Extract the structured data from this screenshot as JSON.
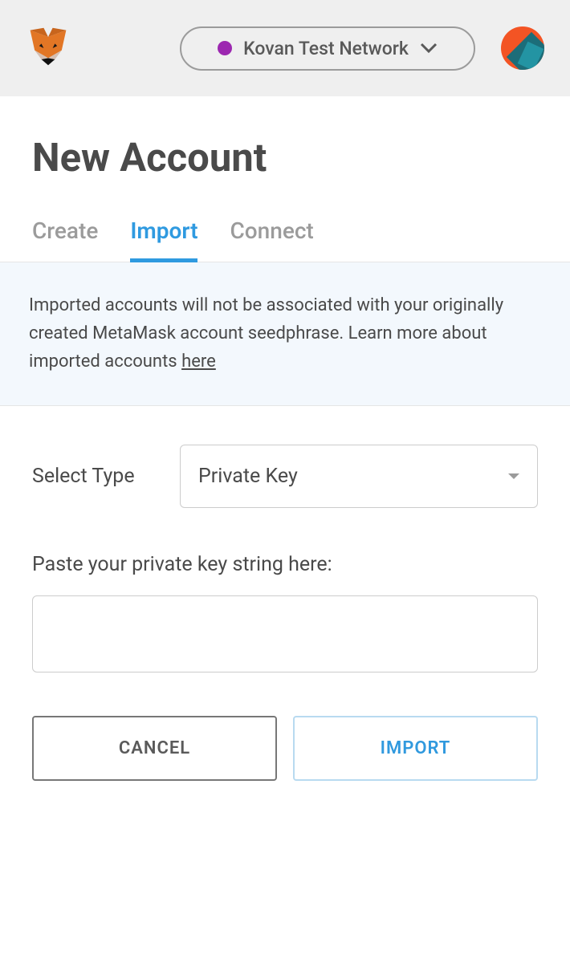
{
  "header": {
    "network_label": "Kovan Test Network",
    "network_color": "#9c27b0"
  },
  "page": {
    "title": "New Account"
  },
  "tabs": {
    "create": "Create",
    "import": "Import",
    "connect": "Connect",
    "active": "import"
  },
  "info": {
    "text": "Imported accounts will not be associated with your originally created MetaMask account seedphrase. Learn more about imported accounts ",
    "link_text": "here"
  },
  "form": {
    "select_label": "Select Type",
    "select_value": "Private Key",
    "input_label": "Paste your private key string here:",
    "input_value": ""
  },
  "buttons": {
    "cancel": "CANCEL",
    "import": "IMPORT"
  }
}
